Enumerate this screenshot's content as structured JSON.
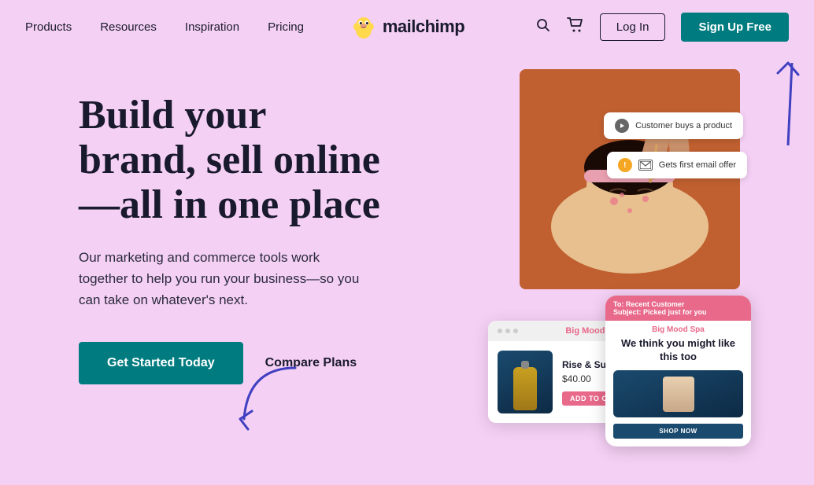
{
  "nav": {
    "links": [
      {
        "label": "Products",
        "id": "products"
      },
      {
        "label": "Resources",
        "id": "resources"
      },
      {
        "label": "Inspiration",
        "id": "inspiration"
      },
      {
        "label": "Pricing",
        "id": "pricing"
      }
    ],
    "logo_text": "mailchimp",
    "login_label": "Log In",
    "signup_label": "Sign Up Free"
  },
  "hero": {
    "headline_line1": "Build your",
    "headline_line2": "brand, sell online",
    "headline_line3": "—all in one place",
    "subtext": "Our marketing and commerce tools work together to help you run your business—so you can take on whatever's next.",
    "cta_primary": "Get Started Today",
    "cta_secondary": "Compare Plans"
  },
  "notifications": {
    "bubble1_text": "Customer buys a product",
    "bubble2_text": "Gets first email offer"
  },
  "ecom_card": {
    "site_name": "Big Mood Spa",
    "product_name": "Rise & Sunshine Serum",
    "price": "$40.00",
    "add_cart": "ADD TO CART"
  },
  "mobile_card": {
    "to_line": "To: Recent Customer",
    "subject_line": "Subject: Picked just for you",
    "spa_name": "Big Mood Spa",
    "headline": "We think you might like this too",
    "shop_btn": "SHOP NOW"
  },
  "colors": {
    "bg": "#f5d0f5",
    "teal": "#007c80",
    "dark": "#1a1a2e",
    "pink": "#e8698a",
    "arrow": "#4040c0"
  }
}
